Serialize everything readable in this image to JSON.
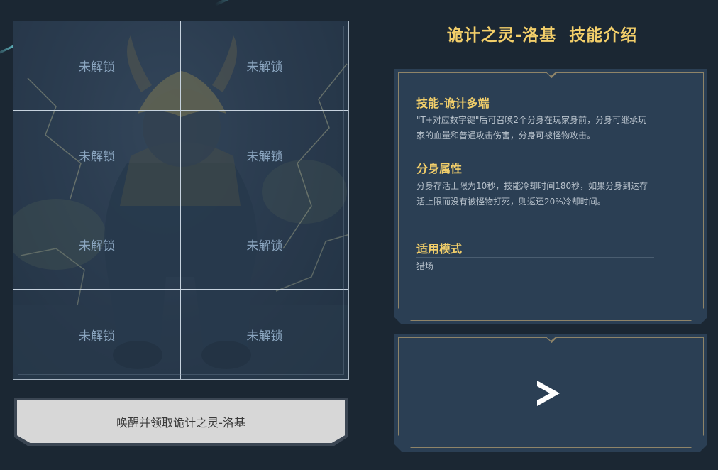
{
  "puzzle": {
    "cells": [
      "未解锁",
      "未解锁",
      "未解锁",
      "未解锁",
      "未解锁",
      "未解锁",
      "未解锁",
      "未解锁"
    ]
  },
  "claim_button": {
    "label": "唤醒并领取诡计之灵-洛基"
  },
  "page_title": "诡计之灵-洛基  技能介绍",
  "skills": [
    {
      "title": "技能-诡计多端",
      "text": "\"T+对应数字键\"后可召唤2个分身在玩家身前，分身可继承玩家的血量和普通攻击伤害，分身可被怪物攻击。"
    },
    {
      "title": "分身属性",
      "text": "分身存活上限为10秒，技能冷却时间180秒，如果分身到达存活上限而没有被怪物打死，则返还20%冷却时间。"
    },
    {
      "title": "适用模式",
      "text": "猎场"
    }
  ],
  "video": {
    "icon": "play-icon"
  },
  "colors": {
    "accent": "#f3cf6a",
    "panel": "#2b3f54",
    "background": "#1b2733"
  }
}
